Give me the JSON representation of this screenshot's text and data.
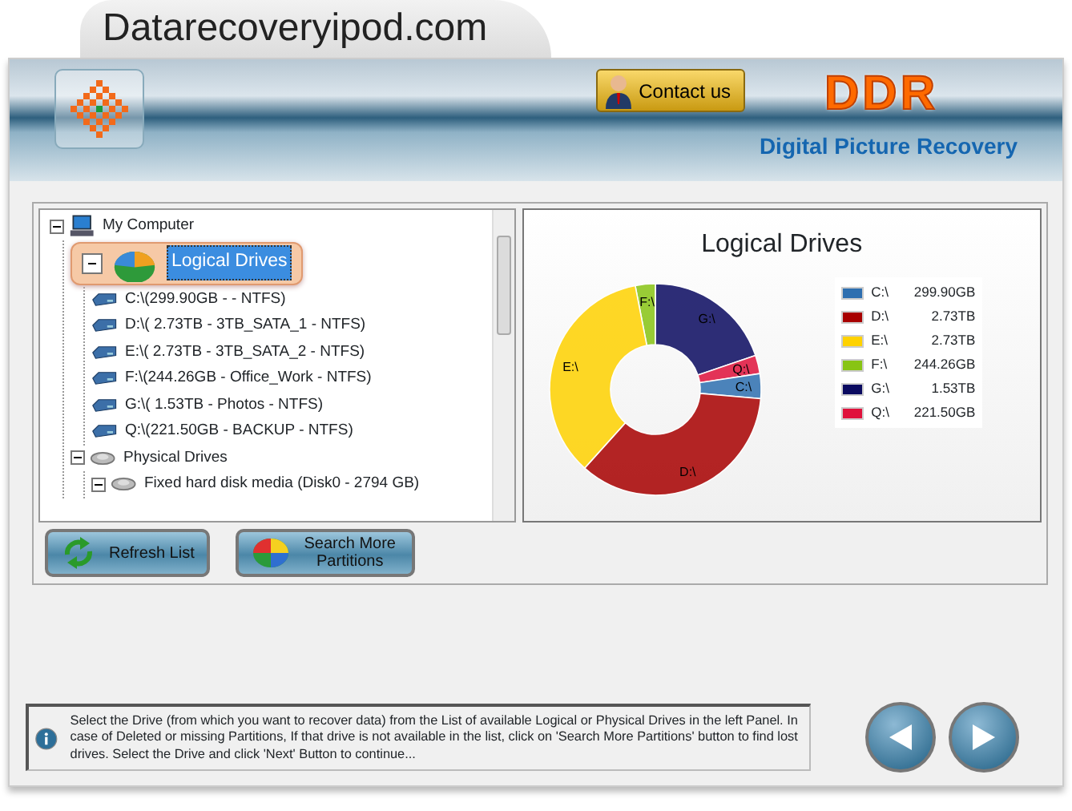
{
  "site_tab": {
    "title": "Datarecoveryipod.com"
  },
  "header": {
    "contact_button": "Contact us",
    "brand": "DDR",
    "product": "Digital Picture Recovery"
  },
  "tree": [
    {
      "label": "My Computer",
      "kind": "computer",
      "expanded": true,
      "selected": false,
      "children": [
        {
          "label": "Logical Drives",
          "kind": "logical",
          "expanded": true,
          "selected": true,
          "children": [
            {
              "label": "C:\\(299.90GB -  - NTFS)",
              "kind": "drive",
              "selected": false
            },
            {
              "label": "D:\\( 2.73TB - 3TB_SATA_1 - NTFS)",
              "kind": "drive",
              "selected": false
            },
            {
              "label": "E:\\( 2.73TB - 3TB_SATA_2 - NTFS)",
              "kind": "drive",
              "selected": false
            },
            {
              "label": "F:\\(244.26GB - Office_Work - NTFS)",
              "kind": "drive",
              "selected": false
            },
            {
              "label": "G:\\( 1.53TB - Photos - NTFS)",
              "kind": "drive",
              "selected": false
            },
            {
              "label": "Q:\\(221.50GB - BACKUP - NTFS)",
              "kind": "drive",
              "selected": false
            }
          ]
        },
        {
          "label": "Physical Drives",
          "kind": "physical",
          "expanded": true,
          "selected": false,
          "children": [
            {
              "label": "Fixed hard disk media (Disk0 - 2794 GB)",
              "kind": "disk",
              "expanded": true,
              "selected": false
            }
          ]
        }
      ]
    }
  ],
  "chart": {
    "title": "Logical Drives",
    "chart_data": {
      "type": "donut",
      "categories": [
        "C:\\",
        "D:\\",
        "E:\\",
        "F:\\",
        "G:\\",
        "Q:\\"
      ],
      "values": [
        3.79,
        35.28,
        35.28,
        3.08,
        19.77,
        2.8
      ]
    },
    "legend": [
      {
        "label": "C:\\",
        "value": "299.90GB",
        "color": "#2e6fb0"
      },
      {
        "label": "D:\\",
        "value": "2.73TB",
        "color": "#a80000"
      },
      {
        "label": "E:\\",
        "value": "2.73TB",
        "color": "#ffd200"
      },
      {
        "label": "F:\\",
        "value": "244.26GB",
        "color": "#88c414"
      },
      {
        "label": "G:\\",
        "value": "1.53TB",
        "color": "#0a0a60"
      },
      {
        "label": "Q:\\",
        "value": "221.50GB",
        "color": "#e0123c"
      }
    ]
  },
  "buttons": [
    {
      "label": "Refresh List",
      "kind": "refresh"
    },
    {
      "label": "Search More Partitions",
      "kind": "search"
    }
  ],
  "info": {
    "text": "Select the Drive (from which you want to recover data) from the List of available Logical or Physical Drives in the left Panel. In case of Deleted or missing Partitions, If that drive is not available in the list, click on 'Search More Partitions' button to find lost drives. Select the Drive and click 'Next' Button to continue..."
  }
}
